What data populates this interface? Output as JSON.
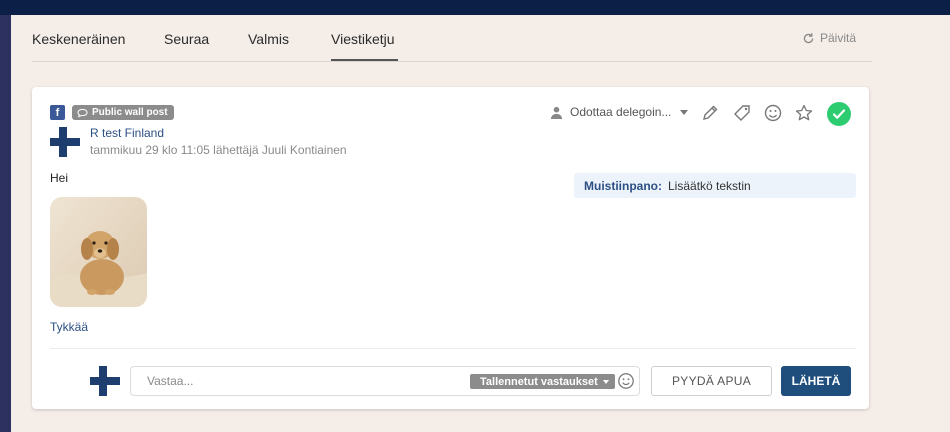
{
  "tabs": [
    {
      "label": "Keskeneräinen"
    },
    {
      "label": "Seuraa"
    },
    {
      "label": "Valmis"
    },
    {
      "label": "Viestiketju",
      "active": true
    }
  ],
  "refresh_label": "Päivitä",
  "post": {
    "source_icon": "facebook-icon",
    "type_badge": "Public wall post",
    "author": "R test Finland",
    "meta": "tammikuu 29 klo 11:05 lähettäjä Juuli Kontiainen",
    "message": "Hei",
    "like_label": "Tykkää",
    "assignee": "Odottaa delegoin...",
    "note_label": "Muistiinpano:",
    "note_text": "Lisäätkö tekstin"
  },
  "reply": {
    "placeholder": "Vastaa...",
    "saved_replies_label": "Tallennetut vastaukset",
    "help_label": "PYYDÄ APUA",
    "send_label": "LÄHETÄ"
  },
  "colors": {
    "topbar": "#0c1f47",
    "leftbar": "#2c3160",
    "background": "#f5ede8",
    "link": "#2c4f84",
    "send_button": "#1f4e7d",
    "done_button": "#2ecc71",
    "facebook": "#3b5998"
  }
}
